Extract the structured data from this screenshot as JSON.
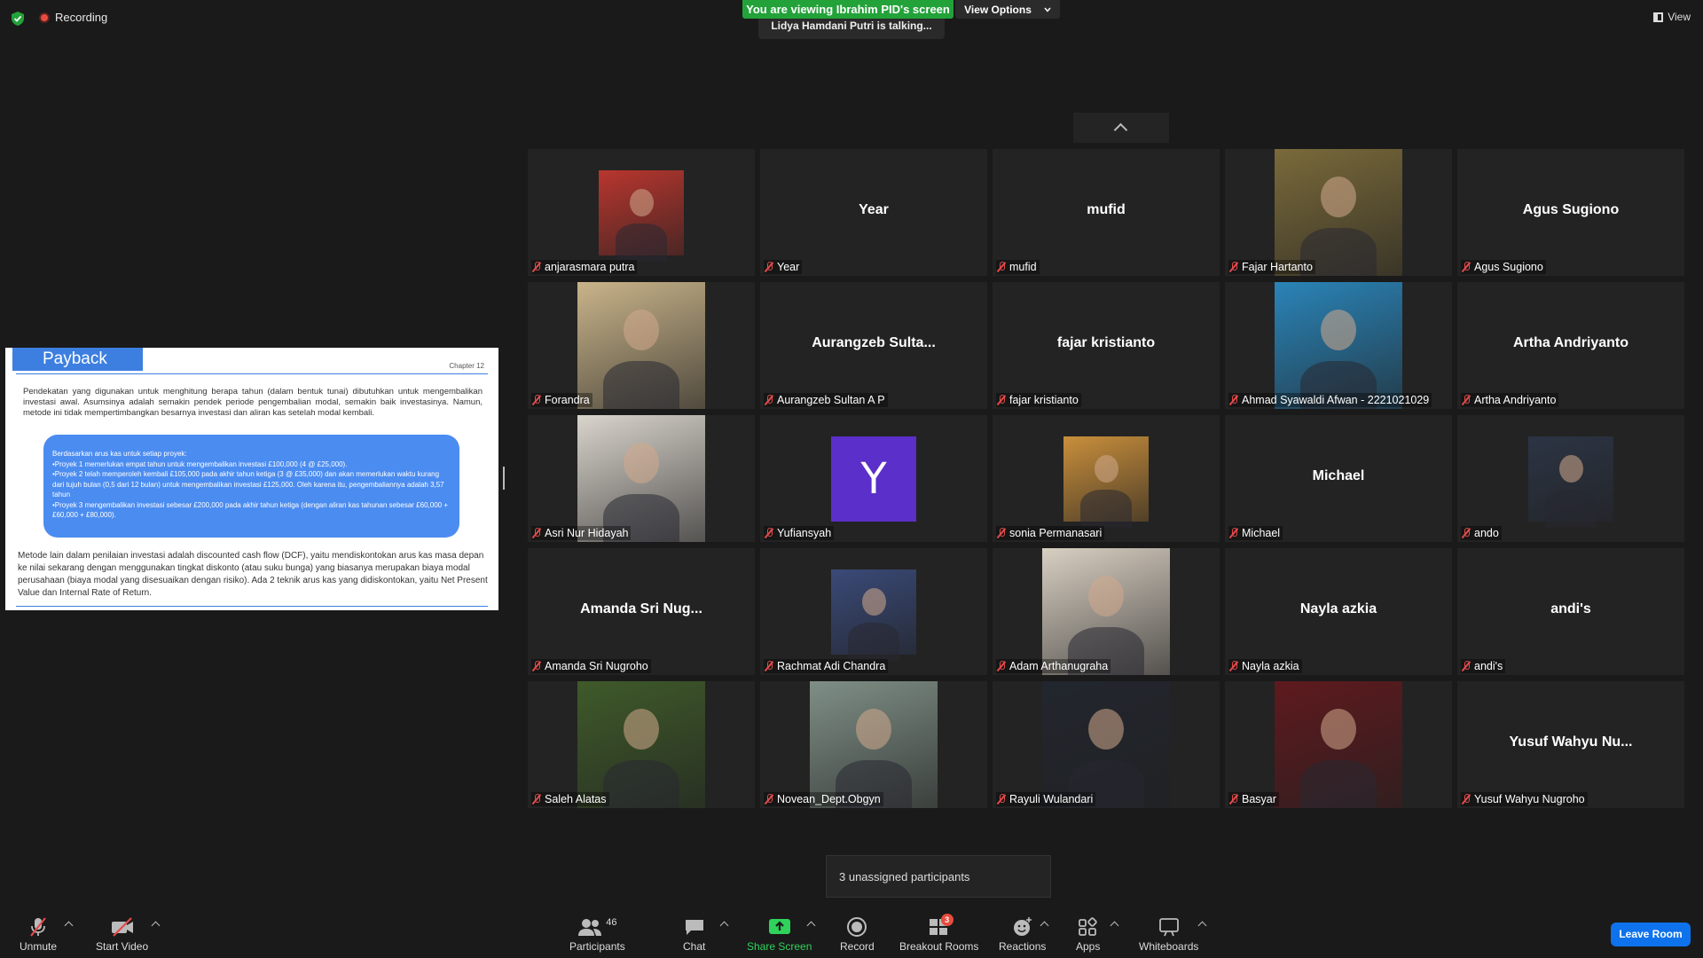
{
  "top": {
    "recording": "Recording",
    "viewing_banner": "You are viewing Ibrahim PID's screen",
    "view_options": "View Options",
    "talking": "Lidya Hamdani Putri is talking...",
    "view": "View"
  },
  "slide": {
    "title": "Payback",
    "chapter": "Chapter 12",
    "para1": "Pendekatan yang digunakan untuk menghitung berapa tahun (dalam bentuk tunai) dibutuhkan untuk mengembalikan investasi awal. Asumsinya adalah semakin pendek periode pengembalian modal, semakin baik investasinya. Namun, metode ini tidak mempertimbangkan besarnya investasi dan aliran kas setelah modal kembali.",
    "bubble": [
      "Berdasarkan arus kas untuk setiap proyek:",
      "•Proyek 1 memerlukan empat tahun untuk mengembalikan investasi £100,000 (4 @ £25,000).",
      "•Proyek 2 telah memperoleh kembali £105,000 pada akhir tahun ketiga (3 @ £35,000) dan akan memerlukan waktu kurang dari tujuh bulan (0,5 dari 12 bulan) untuk mengembalikan investasi £125,000. Oleh karena itu, pengembaliannya adalah 3,57 tahun",
      "•Proyek 3 mengembalikan investasi sebesar £200,000 pada akhir tahun ketiga (dengan aliran kas tahunan sebesar £60,000 + £60,000 + £80,000)."
    ],
    "para2": "Metode lain dalam penilaian investasi adalah discounted cash flow (DCF), yaitu mendiskontokan arus kas masa depan ke nilai sekarang dengan menggunakan tingkat diskonto (atau suku bunga) yang biasanya merupakan biaya modal perusahaan (biaya modal yang disesuaikan dengan risiko). Ada 2 teknik arus kas yang didiskontokan, yaitu Net Present Value dan Internal Rate of Return."
  },
  "participants": [
    {
      "label": "anjarasmara putra",
      "center": "",
      "photo": "#b8362e"
    },
    {
      "label": "Year",
      "center": "Year",
      "photo": ""
    },
    {
      "label": "mufid",
      "center": "mufid",
      "photo": ""
    },
    {
      "label": "Fajar Hartanto",
      "center": "",
      "photo": "#7a6a3a"
    },
    {
      "label": "Agus Sugiono",
      "center": "Agus Sugiono",
      "photo": ""
    },
    {
      "label": "Forandra",
      "center": "",
      "photo": "#c9b48a"
    },
    {
      "label": "Aurangzeb Sultan A P",
      "center": "Aurangzeb  Sulta...",
      "photo": ""
    },
    {
      "label": "fajar kristianto",
      "center": "fajar kristianto",
      "photo": ""
    },
    {
      "label": "Ahmad Syawaldi Afwan - 2221021029",
      "center": "",
      "photo": "#2a84b8"
    },
    {
      "label": "Artha Andriyanto",
      "center": "Artha Andriyanto",
      "photo": ""
    },
    {
      "label": "Asri Nur Hidayah",
      "center": "",
      "photo": "#d9d4cc"
    },
    {
      "label": "Yufiansyah",
      "center": "",
      "photo": "",
      "letter": "Y"
    },
    {
      "label": "sonia Permanasari",
      "center": "",
      "photo": "#c98f3c"
    },
    {
      "label": "Michael",
      "center": "Michael",
      "photo": ""
    },
    {
      "label": "ando",
      "center": "",
      "photo": "#2c3444"
    },
    {
      "label": "Amanda Sri Nugroho",
      "center": "Amanda  Sri  Nug...",
      "photo": ""
    },
    {
      "label": "Rachmat Adi Chandra",
      "center": "",
      "photo": "#3a4a78"
    },
    {
      "label": "Adam Arthanugraha",
      "center": "",
      "photo": "#d8cfc2"
    },
    {
      "label": "Nayla azkia",
      "center": "Nayla azkia",
      "photo": ""
    },
    {
      "label": "andi's",
      "center": "andi's",
      "photo": ""
    },
    {
      "label": "Saleh Alatas",
      "center": "",
      "photo": "#3f5a2a"
    },
    {
      "label": "Novean_Dept.Obgyn",
      "center": "",
      "photo": "#7f8f86"
    },
    {
      "label": "Rayuli Wulandari",
      "center": "",
      "photo": "#22262e"
    },
    {
      "label": "Basyar",
      "center": "",
      "photo": "#5e1a1e"
    },
    {
      "label": "Yusuf Wahyu Nugroho",
      "center": "Yusuf  Wahyu  Nu...",
      "photo": ""
    }
  ],
  "unassigned": "3 unassigned participants",
  "toolbar": {
    "unmute": "Unmute",
    "start_video": "Start Video",
    "participants": "Participants",
    "participants_count": "46",
    "chat": "Chat",
    "share_screen": "Share Screen",
    "record": "Record",
    "breakout_rooms": "Breakout Rooms",
    "breakout_badge": "3",
    "reactions": "Reactions",
    "apps": "Apps",
    "whiteboards": "Whiteboards",
    "leave": "Leave Room"
  },
  "colors": {
    "green": "#23a23a",
    "leave_blue": "#0e72ed",
    "slide_blue": "#3d7fe0",
    "avatar_purple": "#5b2fc9",
    "mic_red": "#e34b4b"
  }
}
